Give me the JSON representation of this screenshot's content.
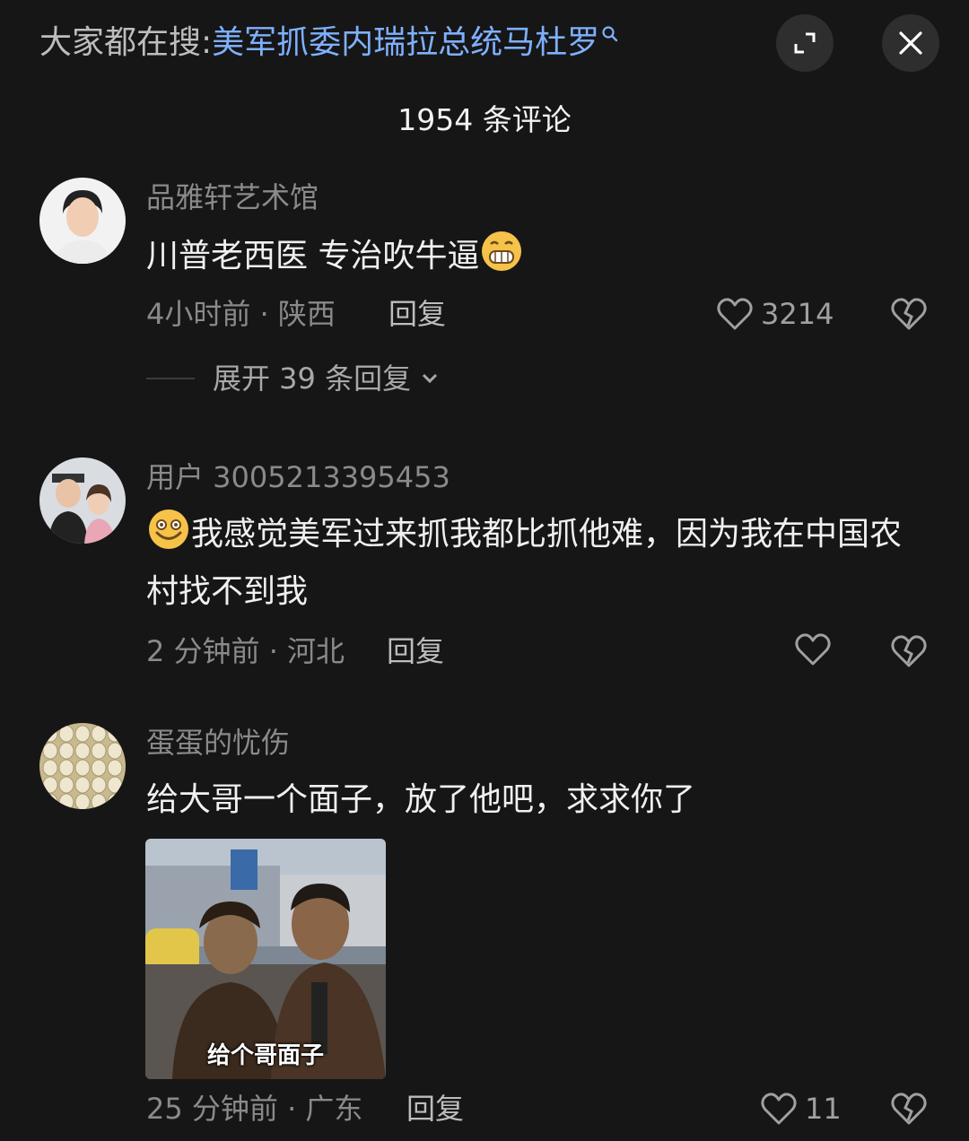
{
  "header": {
    "hot_search_prefix": "大家都在搜:",
    "hot_search_query": "美军抓委内瑞拉总统马杜罗",
    "comment_count_title": "1954 条评论"
  },
  "comments": [
    {
      "username": "品雅轩艺术馆",
      "text": "川普老西医 专治吹牛逼",
      "emoji_after": "grimace-emoji",
      "time_location": "4小时前 · 陕西",
      "reply_label": "回复",
      "likes": "3214",
      "expand_replies": "展开 39 条回复"
    },
    {
      "username": "用户 3005213395453",
      "emoji_before": "smile-emoji",
      "text": "我感觉美军过来抓我都比抓他难，因为我在中国农村找不到我",
      "time_location": "2 分钟前 · 河北",
      "reply_label": "回复",
      "likes": ""
    },
    {
      "username": "蛋蛋的忧伤",
      "text": "给大哥一个面子，放了他吧，求求你了",
      "image_caption": "给个哥面子",
      "time_location": "25 分钟前 · 广东",
      "reply_label": "回复",
      "likes": "11"
    }
  ],
  "colors": {
    "background": "#161616",
    "link": "#7fb0ff",
    "muted": "#8a8a8a"
  }
}
